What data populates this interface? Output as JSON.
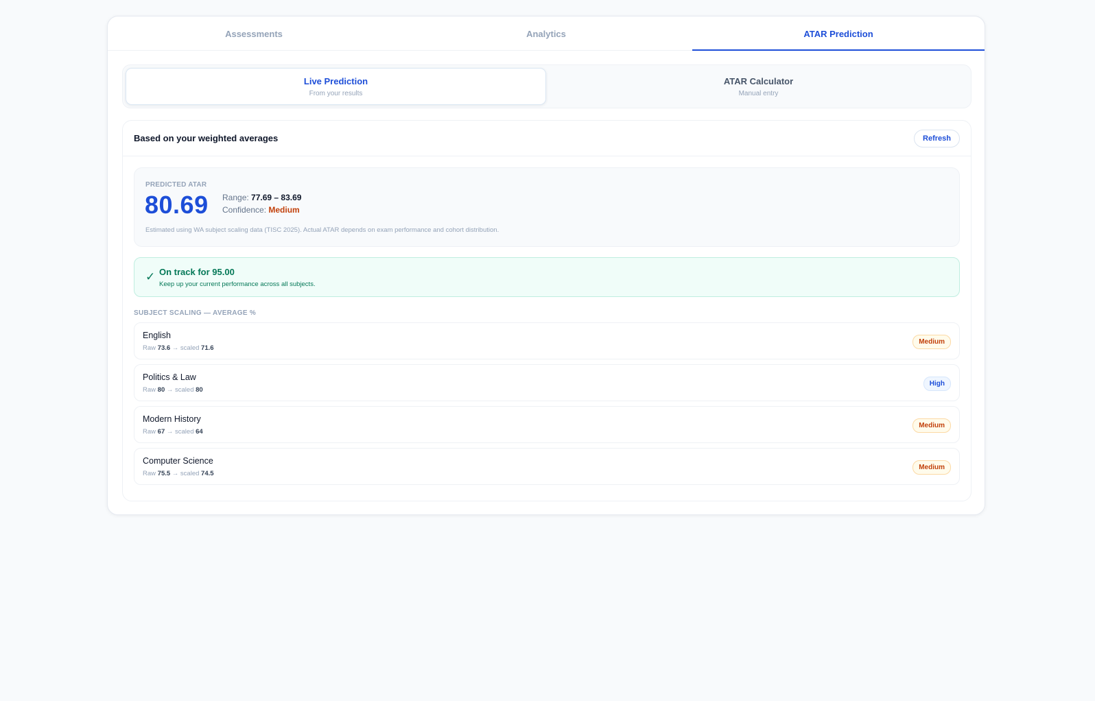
{
  "tabs": [
    {
      "label": "Assessments"
    },
    {
      "label": "Analytics"
    },
    {
      "label": "ATAR Prediction"
    }
  ],
  "subtabs": [
    {
      "title": "Live Prediction",
      "subtitle": "From your results"
    },
    {
      "title": "ATAR Calculator",
      "subtitle": "Manual entry"
    }
  ],
  "panel": {
    "title": "Based on your weighted averages",
    "refresh_label": "Refresh"
  },
  "prediction": {
    "label": "PREDICTED ATAR",
    "value": "80.69",
    "range_label": "Range:",
    "range_value": "77.69 – 83.69",
    "confidence_label": "Confidence:",
    "confidence_value": "Medium",
    "note": "Estimated using WA subject scaling data (TISC 2025). Actual ATAR depends on exam performance and cohort distribution."
  },
  "track": {
    "title": "On track for 95.00",
    "subtitle": "Keep up your current performance across all subjects."
  },
  "scaling": {
    "label": "SUBJECT SCALING — AVERAGE %",
    "raw_label": "Raw",
    "scaled_label": "→ scaled",
    "subjects": [
      {
        "name": "English",
        "raw": "73.6",
        "scaled": "71.6",
        "badge": "Medium"
      },
      {
        "name": "Politics & Law",
        "raw": "80",
        "scaled": "80",
        "badge": "High"
      },
      {
        "name": "Modern History",
        "raw": "67",
        "scaled": "64",
        "badge": "Medium"
      },
      {
        "name": "Computer Science",
        "raw": "75.5",
        "scaled": "74.5",
        "badge": "Medium"
      }
    ]
  },
  "colors": {
    "accent": "#1d4ed8",
    "success": "#047857",
    "warning": "#c2410c"
  }
}
